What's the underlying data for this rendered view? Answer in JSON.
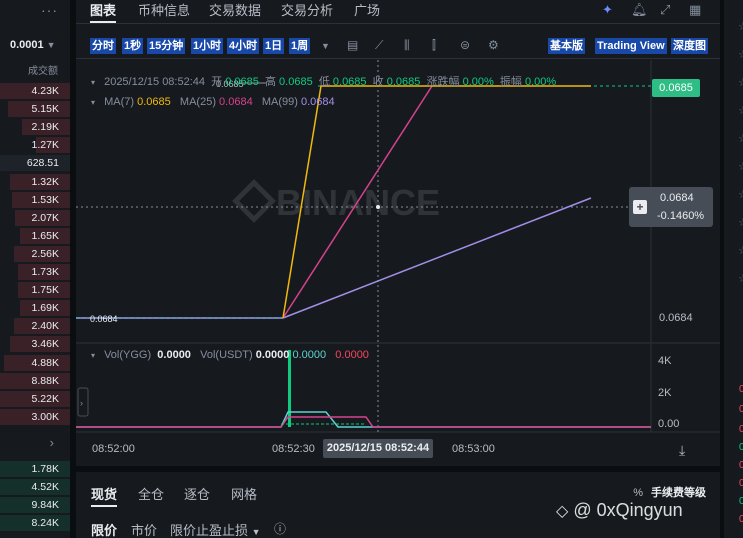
{
  "orderbook": {
    "menu": "···",
    "precision": "0.0001",
    "precision_caret": "▼",
    "volume_header": "成交额",
    "asks": [
      "4.23K",
      "5.15K",
      "2.19K",
      "1.27K",
      "628.51",
      "1.32K",
      "1.53K",
      "2.07K",
      "1.65K",
      "2.56K",
      "1.73K",
      "1.75K",
      "1.69K",
      "2.40K",
      "3.46K",
      "4.88K",
      "8.88K",
      "5.22K",
      "3.00K"
    ],
    "expand_icon": "chevron-right",
    "bids": [
      "1.78K",
      "4.52K",
      "9.84K",
      "8.24K"
    ]
  },
  "topnav": {
    "tabs": [
      "图表",
      "币种信息",
      "交易数据",
      "交易分析",
      "广场"
    ],
    "active_tab": "图表",
    "icons": [
      "sparkle-icon",
      "bell-icon",
      "expand-icon",
      "grid-icon"
    ]
  },
  "toolbar": {
    "intervals": [
      "分时",
      "1秒",
      "15分钟",
      "1小时",
      "4小时",
      "1日",
      "1周"
    ],
    "interval_caret": "▼",
    "tool_icons": [
      "calendar-icon",
      "line-chart-icon",
      "candle-icon",
      "candlestick-icon",
      "indicator-icon",
      "settings-icon"
    ],
    "views": [
      "基本版",
      "Trading View",
      "深度图"
    ]
  },
  "ohlc": {
    "time": "2025/12/15 08:52:44",
    "open_label": "开",
    "open": "0.0685",
    "high_label": "高",
    "high": "0.0685",
    "low_label": "低",
    "low": "0.0685",
    "close_label": "收",
    "close": "0.0685",
    "change_label": "涨跌幅",
    "change": "0.00%",
    "amp_label": "振幅",
    "amp": "0.00%"
  },
  "ma": {
    "ma7_label": "MA(7)",
    "ma7": "0.0685",
    "ma25_label": "MA(25)",
    "ma25": "0.0684",
    "ma99_label": "MA(99)",
    "ma99": "0.0684"
  },
  "vol": {
    "ygg_label": "Vol(YGG)",
    "ygg": "0.0000",
    "usdt_label": "Vol(USDT)",
    "usdt": "0.0000",
    "v2": "0.0000",
    "v3": "0.0000"
  },
  "price_axis": {
    "current_price": "0.0685",
    "crosshair_price": "0.0684",
    "crosshair_change": "-0.1460%",
    "low_tick": "0.0684",
    "low_mark": "0.0684",
    "high_mark": "0.0685"
  },
  "vol_axis": [
    "4K",
    "2K",
    "0.00"
  ],
  "time_axis": {
    "ticks": [
      "08:52:00",
      "08:52:30",
      "08:53:00"
    ],
    "crosshair_time": "2025/12/15 08:52:44"
  },
  "watermark": "BINANCE",
  "bottom": {
    "tabs": [
      "现货",
      "全仓",
      "逐仓",
      "网格"
    ],
    "active_tab": "现货",
    "fee_label": "手续费等级",
    "fee_icon": "%",
    "order_types": [
      "限价",
      "市价",
      "限价止盈止损"
    ],
    "order_caret": "▼",
    "info_icon": "ⓘ"
  },
  "user_watermark": "@ 0xQingyun",
  "colors": {
    "up": "#0ecb81",
    "down": "#f6465d",
    "ma7": "#f0b90b",
    "ma25": "#d6428e",
    "ma99": "#a28ee9",
    "accent_btn": "#1848a8"
  }
}
